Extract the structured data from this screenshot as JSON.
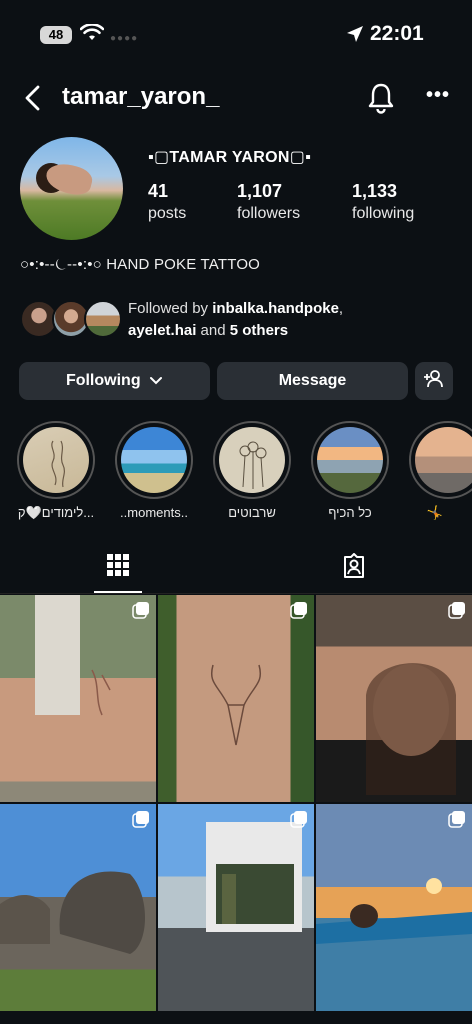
{
  "status_bar": {
    "battery": "48",
    "time": "22:01"
  },
  "header": {
    "username": "tamar_yaron_"
  },
  "profile": {
    "display_name": "▪▢TAMAR YARON▢▪",
    "stats": [
      {
        "value": "41",
        "label": "posts"
      },
      {
        "value": "1,107",
        "label": "followers"
      },
      {
        "value": "1,133",
        "label": "following"
      }
    ],
    "bio": "○•:•--⏾--•:•○ HAND POKE TATTOO",
    "followed_by": {
      "prefix": "Followed by ",
      "user1": "inbalka.handpoke",
      "sep": ",",
      "user2": "ayelet.hai",
      "and": " and ",
      "others": "5 others"
    }
  },
  "actions": {
    "following": "Following",
    "message": "Message"
  },
  "highlights": [
    {
      "label": "לימודים🤍ק..."
    },
    {
      "label": "..moments.."
    },
    {
      "label": "שרבוטים"
    },
    {
      "label": "כל הכיף"
    },
    {
      "label": "🤸"
    }
  ],
  "colors": {
    "background": "#0c1014",
    "button": "#2a2f35",
    "text": "#f5f5f5"
  }
}
